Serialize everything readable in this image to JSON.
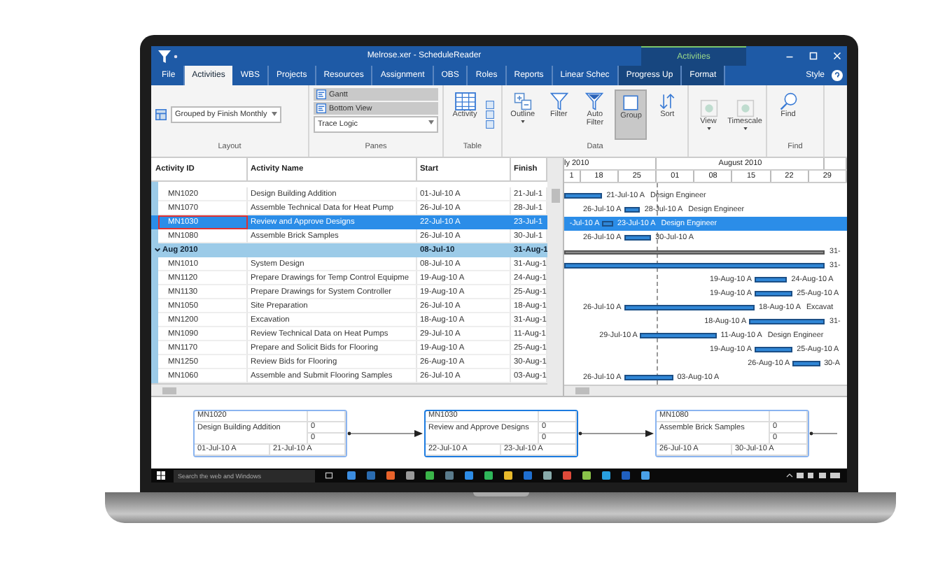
{
  "window": {
    "title": "Melrose.xer - ScheduleReader",
    "context_tab": "Activities",
    "style_menu": "Style"
  },
  "tabs": [
    {
      "label": "File",
      "selected": false,
      "contextual": false
    },
    {
      "label": "Activities",
      "selected": true,
      "contextual": false
    },
    {
      "label": "WBS",
      "selected": false,
      "contextual": false
    },
    {
      "label": "Projects",
      "selected": false,
      "contextual": false
    },
    {
      "label": "Resources",
      "selected": false,
      "contextual": false
    },
    {
      "label": "Assignment",
      "selected": false,
      "contextual": false
    },
    {
      "label": "OBS",
      "selected": false,
      "contextual": false
    },
    {
      "label": "Roles",
      "selected": false,
      "contextual": false
    },
    {
      "label": "Reports",
      "selected": false,
      "contextual": false
    },
    {
      "label": "Linear Schec",
      "selected": false,
      "contextual": false
    },
    {
      "label": "Progress Up",
      "selected": false,
      "contextual": true
    },
    {
      "label": "Format",
      "selected": false,
      "contextual": true
    }
  ],
  "ribbon": {
    "layout": {
      "label": "Layout",
      "dropdown": "Grouped by Finish Monthly"
    },
    "panes": {
      "label": "Panes",
      "toggles": [
        {
          "label": "Gantt",
          "selected": true
        },
        {
          "label": "Bottom View",
          "selected": true
        }
      ],
      "dropdown": "Trace Logic"
    },
    "table": {
      "label": "Table",
      "button": "Activity"
    },
    "data": {
      "label": "Data",
      "buttons": [
        {
          "label": "Outline",
          "menu": true,
          "selected": false
        },
        {
          "label": "Filter",
          "menu": false,
          "selected": false
        },
        {
          "label": "Auto Filter",
          "menu": false,
          "selected": false
        },
        {
          "label": "Group",
          "menu": false,
          "selected": true
        },
        {
          "label": "Sort",
          "menu": false,
          "selected": false
        }
      ]
    },
    "view": {
      "buttons": [
        {
          "label": "View",
          "menu": true,
          "selected": false
        },
        {
          "label": "Timescale",
          "menu": true,
          "selected": false
        }
      ]
    },
    "find": {
      "label": "Find",
      "button": "Find"
    }
  },
  "table": {
    "columns": [
      "Activity ID",
      "Activity Name",
      "Start",
      "Finish"
    ],
    "rows": [
      {
        "kind": "activity",
        "id": "MN1020",
        "name": "Design Building Addition",
        "start": "01-Jul-10 A",
        "finish": "21-Jul-1",
        "selected": false
      },
      {
        "kind": "activity",
        "id": "MN1070",
        "name": "Assemble Technical Data for Heat Pump",
        "start": "26-Jul-10 A",
        "finish": "28-Jul-1",
        "selected": false
      },
      {
        "kind": "activity",
        "id": "MN1030",
        "name": "Review and Approve Designs",
        "start": "22-Jul-10 A",
        "finish": "23-Jul-1",
        "selected": true
      },
      {
        "kind": "activity",
        "id": "MN1080",
        "name": "Assemble Brick Samples",
        "start": "26-Jul-10 A",
        "finish": "30-Jul-1",
        "selected": false
      },
      {
        "kind": "group",
        "label": "Aug 2010",
        "start": "08-Jul-10",
        "finish": "31-Aug-1",
        "expanded": true,
        "selected": false
      },
      {
        "kind": "activity",
        "id": "MN1010",
        "name": "System Design",
        "start": "08-Jul-10 A",
        "finish": "31-Aug-1",
        "selected": false
      },
      {
        "kind": "activity",
        "id": "MN1120",
        "name": "Prepare Drawings for Temp Control Equipme",
        "start": "19-Aug-10 A",
        "finish": "24-Aug-1",
        "selected": false
      },
      {
        "kind": "activity",
        "id": "MN1130",
        "name": "Prepare Drawings for System Controller",
        "start": "19-Aug-10 A",
        "finish": "25-Aug-1",
        "selected": false
      },
      {
        "kind": "activity",
        "id": "MN1050",
        "name": "Site Preparation",
        "start": "26-Jul-10 A",
        "finish": "18-Aug-1",
        "selected": false
      },
      {
        "kind": "activity",
        "id": "MN1200",
        "name": "Excavation",
        "start": "18-Aug-10 A",
        "finish": "31-Aug-1",
        "selected": false
      },
      {
        "kind": "activity",
        "id": "MN1090",
        "name": "Review Technical Data on Heat Pumps",
        "start": "29-Jul-10 A",
        "finish": "11-Aug-1",
        "selected": false
      },
      {
        "kind": "activity",
        "id": "MN1170",
        "name": "Prepare and Solicit Bids for Flooring",
        "start": "19-Aug-10 A",
        "finish": "25-Aug-1",
        "selected": false
      },
      {
        "kind": "activity",
        "id": "MN1250",
        "name": "Review Bids for Flooring",
        "start": "26-Aug-10 A",
        "finish": "30-Aug-1",
        "selected": false
      },
      {
        "kind": "activity",
        "id": "MN1060",
        "name": "Assemble and Submit Flooring Samples",
        "start": "26-Jul-10 A",
        "finish": "03-Aug-1",
        "selected": false
      }
    ]
  },
  "gantt": {
    "months": [
      "ly 2010",
      "August 2010"
    ],
    "weeks": [
      "1",
      "18",
      "25",
      "01",
      "08",
      "15",
      "22",
      "29"
    ],
    "rows": [
      {
        "after": "21-Jul-10 A",
        "resource": "Design Engineer"
      },
      {
        "before": "26-Jul-10 A",
        "after": "28-Jul-10 A",
        "resource": "Design Engineer"
      },
      {
        "before": "-Jul-10 A",
        "after": "23-Jul-10 A",
        "resource": "Design Engineer"
      },
      {
        "before": "26-Jul-10 A",
        "after": "30-Jul-10 A"
      },
      {
        "after": "31-"
      },
      {
        "after": "31-"
      },
      {
        "before": "19-Aug-10 A",
        "after": "24-Aug-10 A"
      },
      {
        "before": "19-Aug-10 A",
        "after": "25-Aug-10 A"
      },
      {
        "before": "26-Jul-10 A",
        "after": "18-Aug-10 A",
        "resource": "Excavat"
      },
      {
        "before": "18-Aug-10 A",
        "after": "31-"
      },
      {
        "before": "29-Jul-10 A",
        "after": "11-Aug-10 A",
        "resource": "Design Engineer"
      },
      {
        "before": "19-Aug-10 A",
        "after": "25-Aug-10 A"
      },
      {
        "before": "26-Aug-10 A",
        "after": "30-A"
      },
      {
        "before": "26-Jul-10 A",
        "after": "03-Aug-10 A"
      }
    ]
  },
  "network": [
    {
      "id": "MN1020",
      "name": "Design Building Addition",
      "value_1": "0",
      "value_2": "0",
      "start": "01-Jul-10 A",
      "finish": "21-Jul-10 A",
      "selected": false
    },
    {
      "id": "MN1030",
      "name": "Review and Approve Designs",
      "value_1": "0",
      "value_2": "0",
      "start": "22-Jul-10 A",
      "finish": "23-Jul-10 A",
      "selected": true
    },
    {
      "id": "MN1080",
      "name": "Assemble Brick Samples",
      "value_1": "0",
      "value_2": "0",
      "start": "26-Jul-10 A",
      "finish": "30-Jul-10 A",
      "selected": false
    }
  ],
  "taskbar": {
    "search": {
      "placeholder": "Search the web and Windows"
    }
  }
}
